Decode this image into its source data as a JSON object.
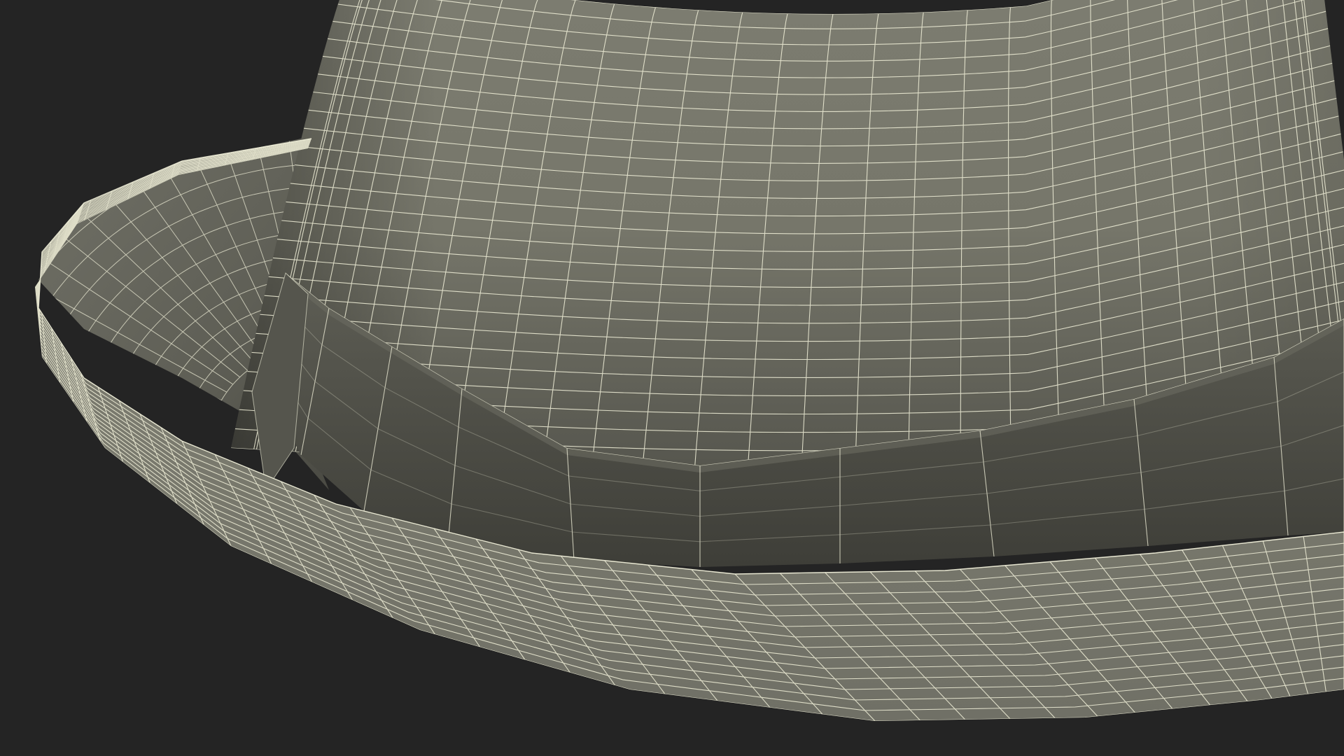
{
  "scene": {
    "subject": "hat-wireframe",
    "colors": {
      "background": "#242424",
      "surface_light": "#7c7c70",
      "surface_mid": "#67675d",
      "surface_dark": "#3e3e38",
      "wire": "#f2f1da"
    }
  }
}
